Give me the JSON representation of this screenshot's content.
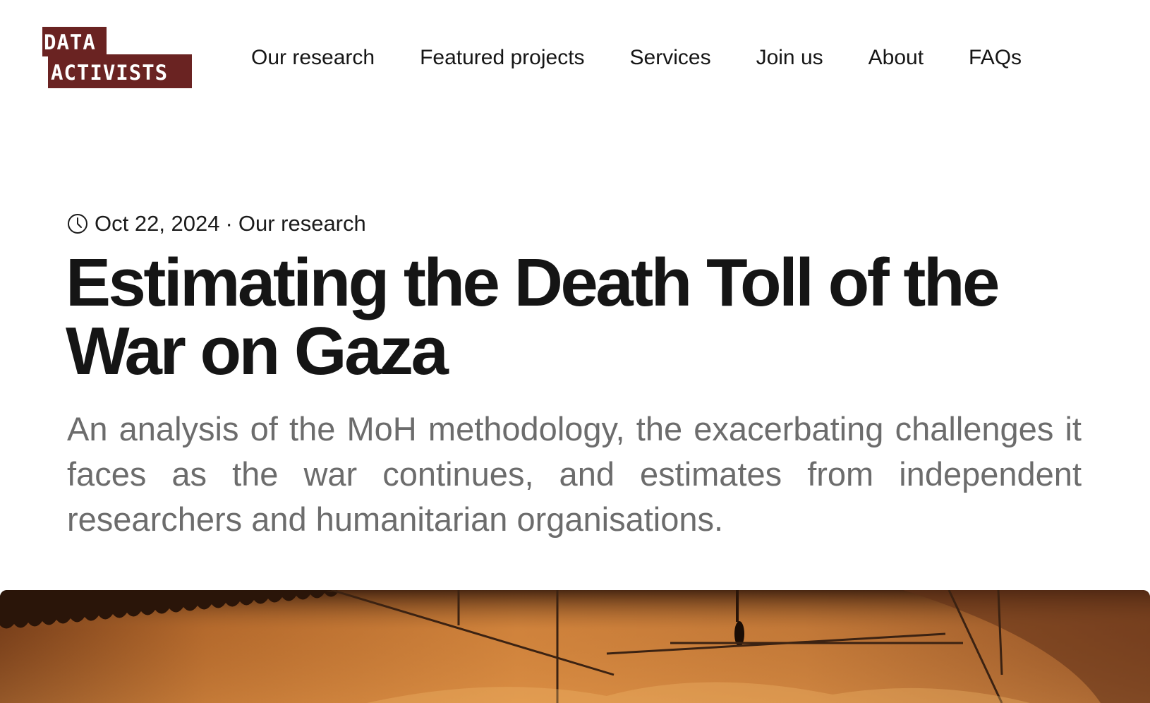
{
  "header": {
    "logo": {
      "line1": "DATA",
      "line2": "ACTIVISTS",
      "color": "#6a2322"
    },
    "nav": [
      {
        "label": "Our research"
      },
      {
        "label": "Featured projects"
      },
      {
        "label": "Services"
      },
      {
        "label": "Join us"
      },
      {
        "label": "About"
      },
      {
        "label": "FAQs"
      }
    ]
  },
  "article": {
    "date": "Oct 22, 2024",
    "separator": "·",
    "category": "Our research",
    "date_icon": "clock-icon",
    "title": "Estimating the Death Toll of the War on Gaza",
    "subtitle": "An analysis of the MoH methodology, the exacerbating challenges it faces as the war continues, and estimates from independent researchers and humanitarian organisations."
  },
  "colors": {
    "accent": "#6a2322",
    "title_text": "#151515",
    "subtitle_text": "#6c6c6c"
  }
}
